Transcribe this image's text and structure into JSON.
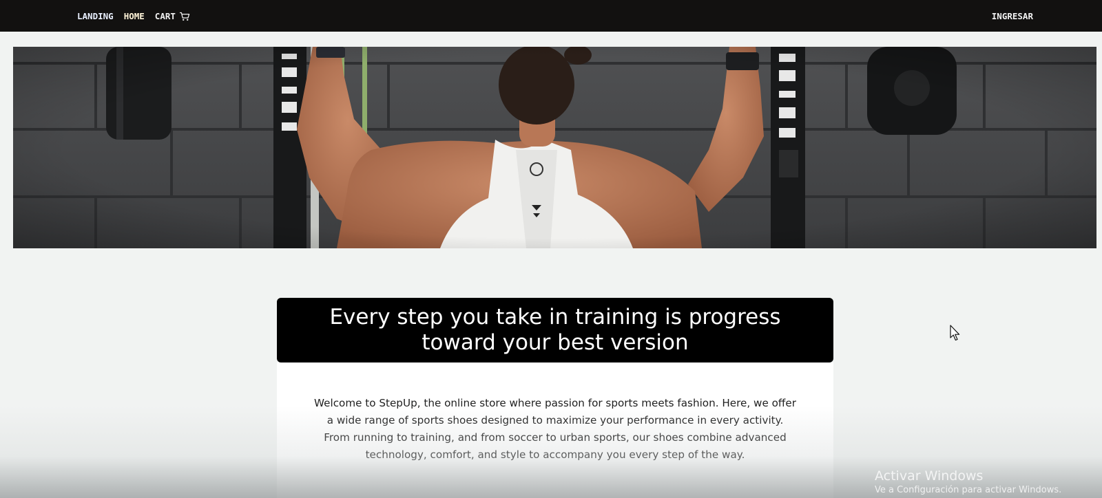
{
  "navbar": {
    "links": {
      "landing": "LANDING",
      "home": "HOME",
      "cart": "CART"
    },
    "cart_icon": "cart-icon",
    "login": "INGRESAR"
  },
  "hero": {
    "image": "athlete-back-weightlifting-photo"
  },
  "main": {
    "headline": "Every step you take in training is progress toward your best version",
    "intro": "Welcome to StepUp, the online store where passion for sports meets fashion. Here, we offer a wide range of sports shoes designed to maximize your performance in every activity. From running to training, and from soccer to urban sports, our shoes combine advanced technology, comfort, and style to accompany you every step of the way."
  },
  "os_watermark": {
    "title": "Activar Windows",
    "subtitle": "Ve a Configuración para activar Windows."
  },
  "colors": {
    "navbar_bg": "#121110",
    "page_bg": "#f1f3f2",
    "headline_bg": "#000000",
    "card_bg": "#ffffff"
  }
}
